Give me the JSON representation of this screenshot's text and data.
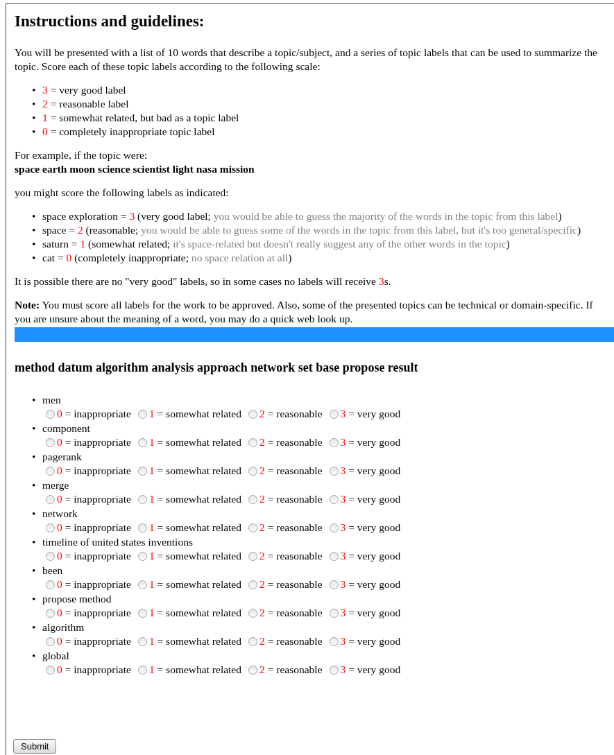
{
  "title": "Instructions and guidelines:",
  "intro": "You will be presented with a list of 10 words that describe a topic/subject, and a series of topic labels that can be used to summarize the topic. Score each of these topic labels  according to the following scale:",
  "scale": [
    {
      "number": "3",
      "text": "= very good label"
    },
    {
      "number": "2",
      "text": "= reasonable label"
    },
    {
      "number": "1",
      "text": "= somewhat related, but bad as a topic label"
    },
    {
      "number": "0",
      "text": "= completely inappropriate topic label"
    }
  ],
  "example_intro": "For example, if the topic were:",
  "example_topic": "space earth moon science scientist light nasa mission",
  "example_lead": "you might score the following labels as indicated:",
  "examples": [
    {
      "label": "space exploration =",
      "score": "3",
      "category": "(very good label;",
      "explanation": "you would be able to guess the majority of the words in the topic from this label",
      "close": ")"
    },
    {
      "label": "space =",
      "score": "2",
      "category": "(reasonable;",
      "explanation": "you would be able to guess some of the words in the topic from this label, but it's too general/specific",
      "close": ")"
    },
    {
      "label": "saturn =",
      "score": "1",
      "category": "(somewhat related;",
      "explanation": "it's space-related but doesn't really suggest any of the other words in the topic",
      "close": ")"
    },
    {
      "label": "cat =",
      "score": "0",
      "category": "(completely inappropriate;",
      "explanation": "no space relation at all",
      "close": ")"
    }
  ],
  "possible_note": {
    "before": "It is possible there are no \"very good\" labels, so in some cases no labels will receive ",
    "highlight": "3",
    "after": "s."
  },
  "note": "**Note:** You must score all labels for the work to be approved. Also, some of the presented topics can be technical or domain-specific. If you are unsure about the meaning of a word, you may do a quick web look up.",
  "topic": "method datum algorithm analysis approach network set base propose result",
  "ratings": [
    {
      "label": "men",
      "options": [
        {
          "number": "0",
          "text": "= inappropriate",
          "selected": false
        },
        {
          "number": "1",
          "text": "= somewhat related",
          "selected": false
        },
        {
          "number": "2",
          "text": "= reasonable",
          "selected": false
        },
        {
          "number": "3",
          "text": "= very good",
          "selected": false
        }
      ]
    },
    {
      "label": "component",
      "options": [
        {
          "number": "0",
          "text": "= inappropriate",
          "selected": false
        },
        {
          "number": "1",
          "text": "= somewhat related",
          "selected": false
        },
        {
          "number": "2",
          "text": "= reasonable",
          "selected": false
        },
        {
          "number": "3",
          "text": "= very good",
          "selected": false
        }
      ]
    },
    {
      "label": "pagerank",
      "options": [
        {
          "number": "0",
          "text": "= inappropriate",
          "selected": false
        },
        {
          "number": "1",
          "text": "= somewhat related",
          "selected": false
        },
        {
          "number": "2",
          "text": "= reasonable",
          "selected": false
        },
        {
          "number": "3",
          "text": "= very good",
          "selected": false
        }
      ]
    },
    {
      "label": "merge",
      "options": [
        {
          "number": "0",
          "text": "= inappropriate",
          "selected": false
        },
        {
          "number": "1",
          "text": "= somewhat related",
          "selected": false
        },
        {
          "number": "2",
          "text": "= reasonable",
          "selected": false
        },
        {
          "number": "3",
          "text": "= very good",
          "selected": false
        }
      ]
    },
    {
      "label": "network",
      "options": [
        {
          "number": "0",
          "text": "= inappropriate",
          "selected": false
        },
        {
          "number": "1",
          "text": "= somewhat related",
          "selected": false
        },
        {
          "number": "2",
          "text": "= reasonable",
          "selected": false
        },
        {
          "number": "3",
          "text": "= very good",
          "selected": false
        }
      ]
    },
    {
      "label": "timeline of united states inventions",
      "options": [
        {
          "number": "0",
          "text": "= inappropriate",
          "selected": false
        },
        {
          "number": "1",
          "text": "= somewhat related",
          "selected": false
        },
        {
          "number": "2",
          "text": "= reasonable",
          "selected": false
        },
        {
          "number": "3",
          "text": "= very good",
          "selected": false
        }
      ]
    },
    {
      "label": "been",
      "options": [
        {
          "number": "0",
          "text": "= inappropriate",
          "selected": false
        },
        {
          "number": "1",
          "text": "= somewhat related",
          "selected": false
        },
        {
          "number": "2",
          "text": "= reasonable",
          "selected": false
        },
        {
          "number": "3",
          "text": "= very good",
          "selected": false
        }
      ]
    },
    {
      "label": "propose method",
      "options": [
        {
          "number": "0",
          "text": "= inappropriate",
          "selected": false
        },
        {
          "number": "1",
          "text": "= somewhat related",
          "selected": false
        },
        {
          "number": "2",
          "text": "= reasonable",
          "selected": false
        },
        {
          "number": "3",
          "text": "= very good",
          "selected": false
        }
      ]
    },
    {
      "label": "algorithm",
      "options": [
        {
          "number": "0",
          "text": "= inappropriate",
          "selected": false
        },
        {
          "number": "1",
          "text": "= somewhat related",
          "selected": false
        },
        {
          "number": "2",
          "text": "= reasonable",
          "selected": false
        },
        {
          "number": "3",
          "text": "= very good",
          "selected": false
        }
      ]
    },
    {
      "label": "global",
      "options": [
        {
          "number": "0",
          "text": "= inappropriate",
          "selected": false
        },
        {
          "number": "1",
          "text": "= somewhat related",
          "selected": false
        },
        {
          "number": "2",
          "text": "= reasonable",
          "selected": false
        },
        {
          "number": "3",
          "text": "= very good",
          "selected": false
        }
      ]
    }
  ],
  "submit": "Submit",
  "bullet": "•"
}
